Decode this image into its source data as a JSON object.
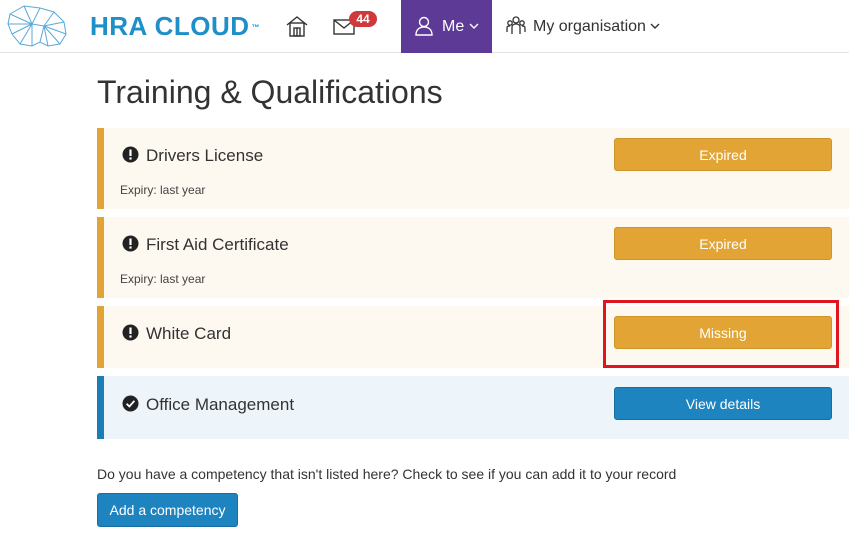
{
  "brand": {
    "name": "HRA CLOUD",
    "trademark": "™"
  },
  "nav": {
    "mail_badge": "44",
    "me_label": "Me",
    "org_label": "My organisation"
  },
  "page": {
    "title": "Training & Qualifications"
  },
  "competencies": [
    {
      "title": "Drivers License",
      "status": "warning",
      "expiry": "Expiry: last year",
      "action": "Expired"
    },
    {
      "title": "First Aid Certificate",
      "status": "warning",
      "expiry": "Expiry: last year",
      "action": "Expired"
    },
    {
      "title": "White Card",
      "status": "warning",
      "expiry": "",
      "action": "Missing"
    },
    {
      "title": "Office Management",
      "status": "ok",
      "expiry": "",
      "action": "View details"
    }
  ],
  "footer": {
    "question": "Do you have a competency that isn't listed here? Check to see if you can add it to your record",
    "add_button": "Add a competency"
  },
  "colors": {
    "brand_blue": "#1f8fc9",
    "nav_active": "#5e3a97",
    "warning": "#e2a535",
    "primary": "#1e84c0",
    "badge": "#d0393a",
    "highlight": "#e0161e"
  }
}
